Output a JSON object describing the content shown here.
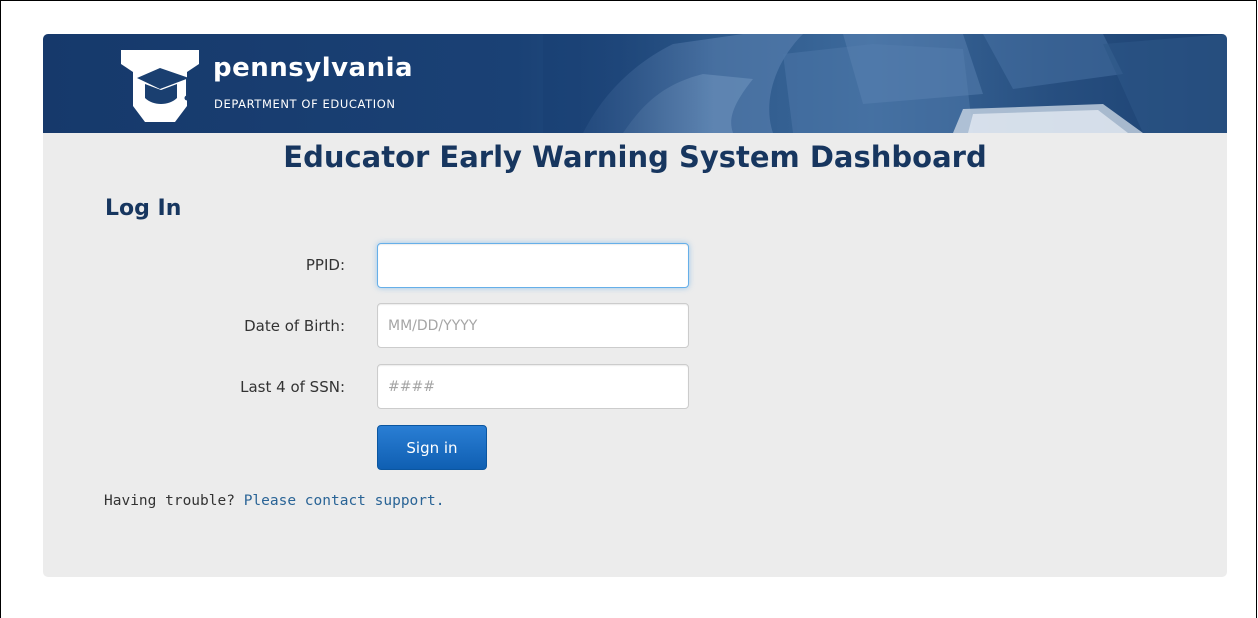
{
  "header": {
    "brand_name": "pennsylvania",
    "brand_subtitle": "DEPARTMENT OF EDUCATION",
    "logo_icon": "keystone-graduation-cap-icon",
    "banner_color": "#1a3f70"
  },
  "page_title": "Educator Early Warning System Dashboard",
  "login": {
    "heading": "Log In",
    "ppid": {
      "label": "PPID:",
      "value": "",
      "placeholder": ""
    },
    "dob": {
      "label": "Date of Birth:",
      "value": "",
      "placeholder": "MM/DD/YYYY"
    },
    "ssn": {
      "label": "Last 4 of SSN:",
      "value": "",
      "placeholder": "####"
    },
    "submit_label": "Sign in"
  },
  "help": {
    "text": "Having trouble?",
    "link_text": "Please contact support."
  },
  "colors": {
    "title": "#17365f",
    "button": "#1a6cc2",
    "link": "#2a6496",
    "card_background": "#ececec"
  }
}
